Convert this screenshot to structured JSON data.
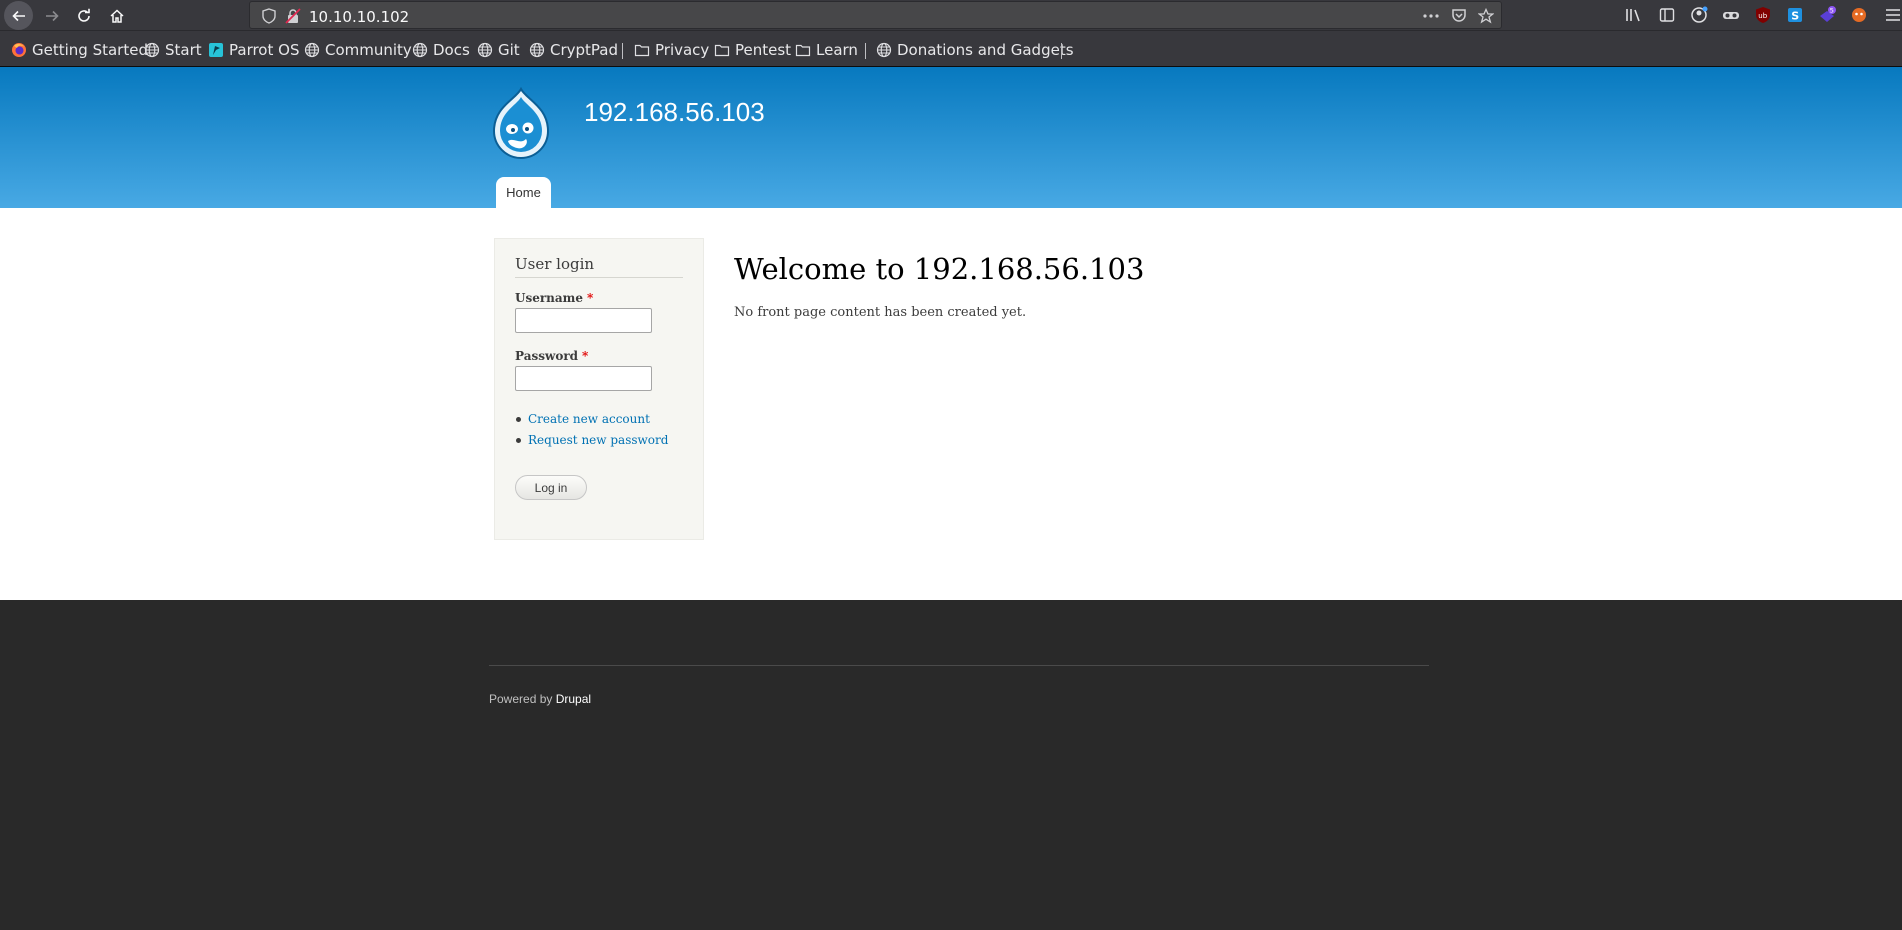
{
  "browser": {
    "url": "10.10.10.102",
    "bookmarks": [
      {
        "label": "Getting Started",
        "icon": "firefox-icon"
      },
      {
        "label": "Start",
        "icon": "globe-icon"
      },
      {
        "label": "Parrot OS",
        "icon": "parrot-icon"
      },
      {
        "label": "Community",
        "icon": "globe-icon"
      },
      {
        "label": "Docs",
        "icon": "globe-icon"
      },
      {
        "label": "Git",
        "icon": "globe-icon"
      },
      {
        "label": "CryptPad",
        "icon": "globe-icon"
      },
      {
        "label": "Privacy",
        "icon": "folder-icon"
      },
      {
        "label": "Pentest",
        "icon": "folder-icon"
      },
      {
        "label": "Learn",
        "icon": "folder-icon"
      },
      {
        "label": "Donations and Gadgets",
        "icon": "globe-icon"
      }
    ],
    "extension_badge": "5"
  },
  "site": {
    "name": "192.168.56.103",
    "nav_home": "Home"
  },
  "login_block": {
    "title": "User login",
    "username_label": "Username",
    "password_label": "Password",
    "required_mark": "*",
    "create_account": "Create new account",
    "request_password": "Request new password",
    "login_button": "Log in"
  },
  "main": {
    "title": "Welcome to 192.168.56.103",
    "body": "No front page content has been created yet."
  },
  "footer": {
    "powered_by": "Powered by",
    "drupal_link": "Drupal"
  }
}
